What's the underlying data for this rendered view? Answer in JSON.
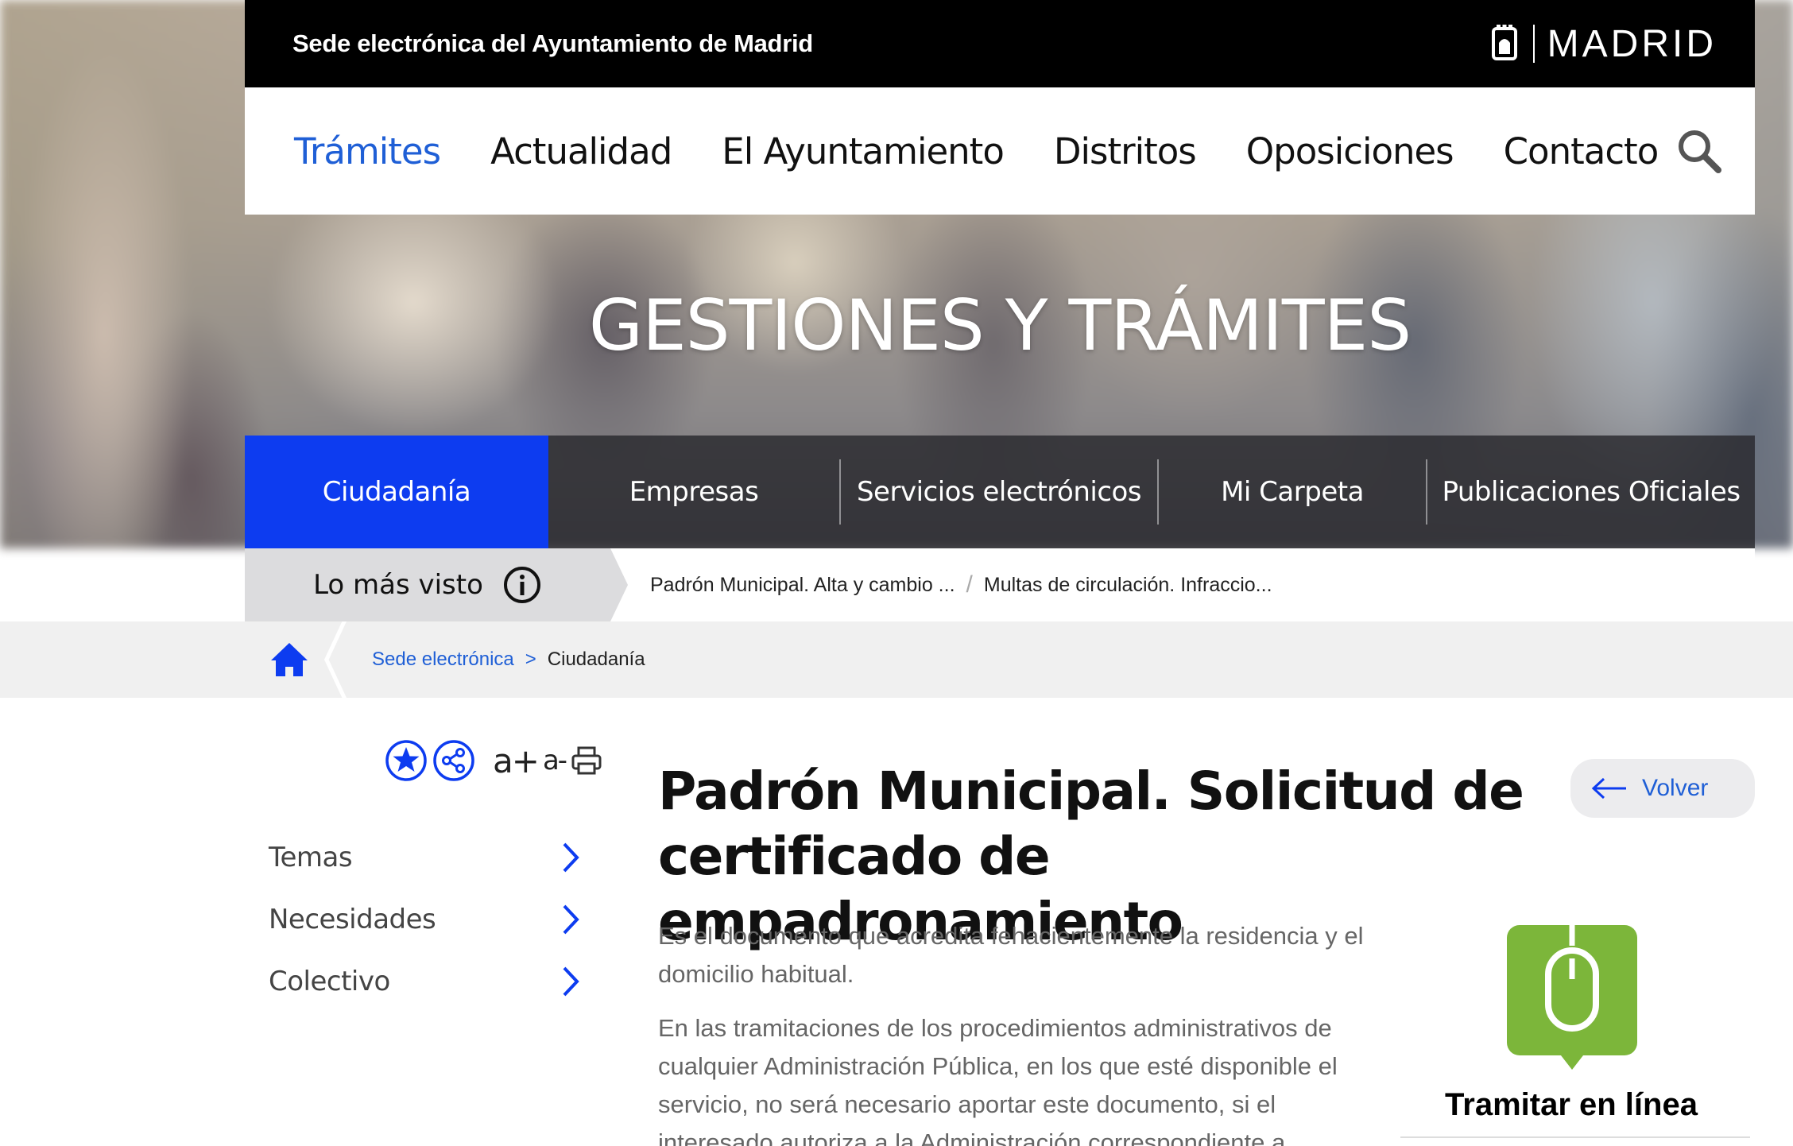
{
  "topbar": {
    "title": "Sede electrónica del Ayuntamiento de Madrid",
    "brand": "MADRID"
  },
  "nav": {
    "items": [
      "Trámites",
      "Actualidad",
      "El Ayuntamiento",
      "Distritos",
      "Oposiciones",
      "Contacto"
    ],
    "active_index": 0,
    "active_color": "#1f5fd6"
  },
  "hero": {
    "title": "GESTIONES Y TRÁMITES"
  },
  "tabs": {
    "items": [
      "Ciudadanía",
      "Empresas",
      "Servicios electrónicos",
      "Mi Carpeta",
      "Publicaciones Oficiales"
    ],
    "active_index": 0,
    "active_color": "#0d3cf0"
  },
  "popular": {
    "label": "Lo más visto",
    "links": [
      "Padrón Municipal. Alta y cambio ...",
      "Multas de circulación. Infraccio..."
    ],
    "separator": "/"
  },
  "breadcrumb": {
    "items": [
      "Sede electrónica",
      "Ciudadanía"
    ],
    "separator": ">"
  },
  "tools": {
    "increase_font": "a+",
    "decrease_font": "a-"
  },
  "side_menu": {
    "items": [
      "Temas",
      "Necesidades",
      "Colectivo"
    ]
  },
  "content": {
    "title": "Padrón Municipal. Solicitud de certificado de empadronamiento",
    "paragraphs": [
      "Es el documento que acredita fehacientemente la residencia y el domicilio habitual.",
      "En las tramitaciones de los procedimientos administrativos de cualquier Administración Pública, en los que esté disponible el servicio, no será necesario aportar este documento, si el interesado autoriza a la Administración correspondiente a"
    ]
  },
  "volver": {
    "label": "Volver"
  },
  "tramitar": {
    "label": "Tramitar en línea",
    "icon_color": "#7cb63a"
  }
}
